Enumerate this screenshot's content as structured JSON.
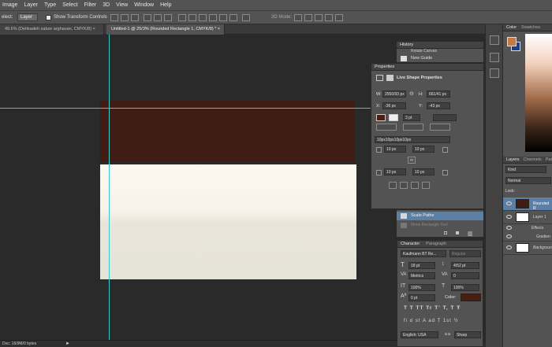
{
  "menu": [
    "Image",
    "Layer",
    "Type",
    "Select",
    "Filter",
    "3D",
    "View",
    "Window",
    "Help"
  ],
  "options": {
    "select_label": "elect:",
    "select_value": "Layer",
    "show_transform": "Show Transform Controls",
    "mode_3d": "3D Mode:"
  },
  "tabs": [
    {
      "label": "49.6% (Dehkadeh sabze arghavan, CMYK/8)",
      "close": "×"
    },
    {
      "label": "Untitled-1 @ 25/3% (Rounded Rectangle 1, CMYK/8) *",
      "close": "×"
    }
  ],
  "status": {
    "doc": "Doc: 16/9M/0 bytes"
  },
  "history": {
    "title": "History",
    "items": [
      "Rotate Canvas",
      "New Guide"
    ],
    "bottom_items": [
      "Scale Paths",
      "Move Rectangle Tool"
    ]
  },
  "properties": {
    "title": "Properties",
    "subtitle": "Live Shape Properties",
    "w_label": "W:",
    "w_value": "2550/93 px",
    "h_label": "H:",
    "h_value": "661/41 px",
    "x_label": "X:",
    "x_value": "-36 px",
    "y_label": "Y:",
    "y_value": "-43 px",
    "stroke_width": "3 pt",
    "corners_text": "10px10px10px10px",
    "corner_tl": "10 px",
    "corner_tr": "10 px",
    "corner_bl": "10 px",
    "corner_br": "10 px"
  },
  "character": {
    "tab1": "Character",
    "tab2": "Paragraph",
    "font": "Kaufmann BT Re...",
    "style": "Regular",
    "size": "18 pt",
    "leading": "4/52 pt",
    "kerning": "Metrics",
    "tracking": "0",
    "vscale": "100%",
    "hscale": "100%",
    "baseline": "0 pt",
    "color_label": "Color:",
    "color": "#4a1e12",
    "language": "English: USA",
    "aa_label": "a a",
    "aa": "Sharp",
    "styles_row": "T  T  TT  Tr  T'  T,  T  Ŧ",
    "ot_row": "fi  σ  st  A  ad  T  1st  ½"
  },
  "color_panel": {
    "tab1": "Color",
    "tab2": "Swatches",
    "fg": "#c47a43",
    "bg": "#1f3b8a"
  },
  "layers": {
    "tab1": "Layers",
    "tab2": "Channels",
    "tab3": "Pat",
    "kind": "Kind",
    "blend": "Normal",
    "lock_label": "Lock:",
    "items": [
      {
        "name": "Rounded R",
        "selected": true
      },
      {
        "name": "Layer 1",
        "selected": false
      },
      {
        "name": "Effects",
        "selected": false
      },
      {
        "name": "Gradien",
        "selected": false
      },
      {
        "name": "Backgroun",
        "selected": false
      }
    ]
  },
  "accent": "#33cccc"
}
